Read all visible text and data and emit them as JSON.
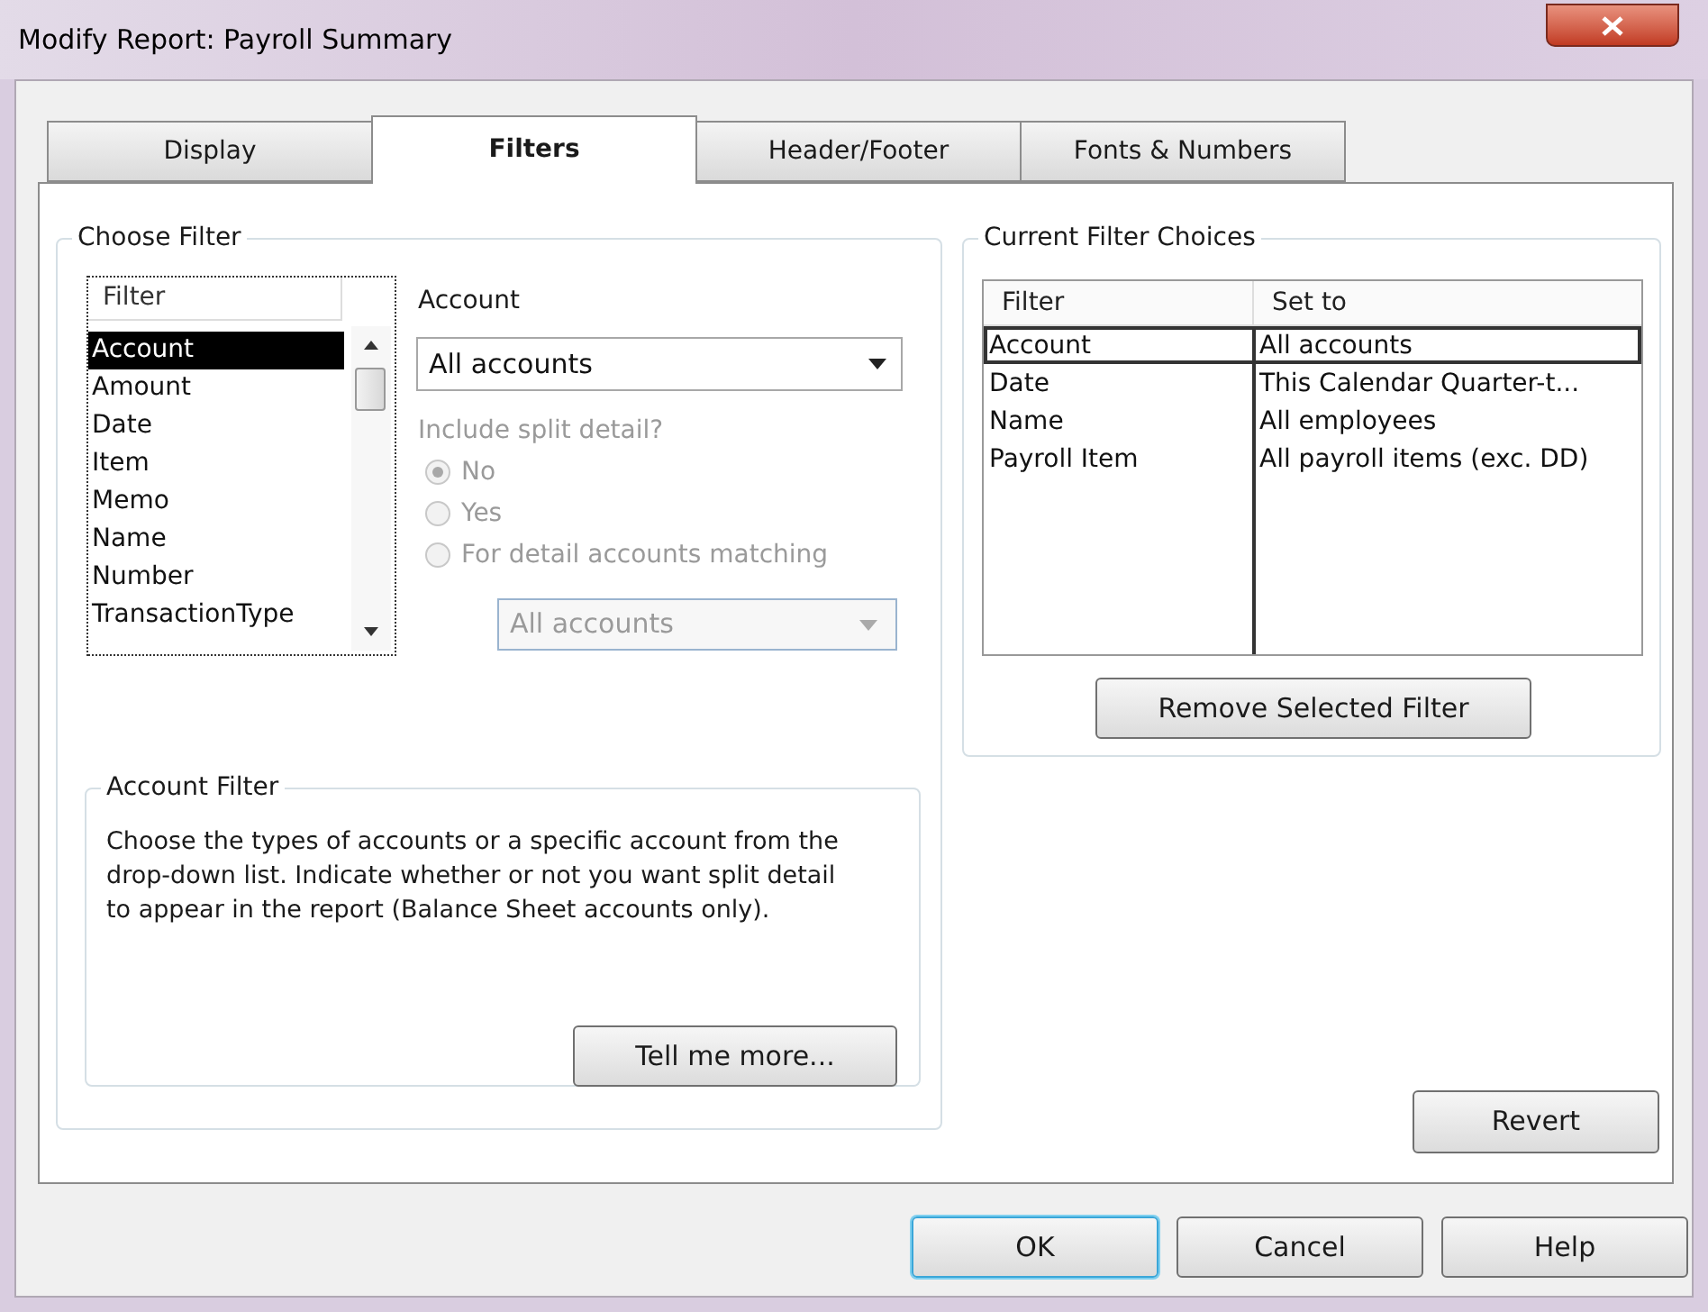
{
  "window": {
    "title": "Modify Report: Payroll Summary"
  },
  "tabs": [
    {
      "label": "Display",
      "selected": false
    },
    {
      "label": "Filters",
      "selected": true
    },
    {
      "label": "Header/Footer",
      "selected": false
    },
    {
      "label": "Fonts & Numbers",
      "selected": false
    }
  ],
  "choose_filter": {
    "title": "Choose Filter",
    "filter_list": {
      "header": "Filter",
      "items": [
        {
          "label": "Account",
          "selected": true
        },
        {
          "label": "Amount",
          "selected": false
        },
        {
          "label": "Date",
          "selected": false
        },
        {
          "label": "Item",
          "selected": false
        },
        {
          "label": "Memo",
          "selected": false
        },
        {
          "label": "Name",
          "selected": false
        },
        {
          "label": "Number",
          "selected": false
        },
        {
          "label": "TransactionType",
          "selected": false
        }
      ]
    },
    "account_label": "Account",
    "account_dropdown": {
      "value": "All accounts"
    },
    "split_detail": {
      "label": "Include split detail?",
      "disabled": true,
      "options": [
        {
          "label": "No",
          "selected": true
        },
        {
          "label": "Yes",
          "selected": false
        },
        {
          "label": "For detail accounts matching",
          "selected": false
        }
      ],
      "match_dropdown": {
        "value": "All accounts"
      }
    },
    "account_filter": {
      "title": "Account Filter",
      "text": "Choose the types of accounts or a specific account from the drop-down list. Indicate whether or not you want split detail to appear in the report (Balance Sheet accounts only).",
      "button": "Tell me more..."
    }
  },
  "current_filter_choices": {
    "title": "Current Filter Choices",
    "columns": [
      "Filter",
      "Set to"
    ],
    "rows": [
      {
        "filter": "Account",
        "set_to": "All accounts",
        "selected": true
      },
      {
        "filter": "Date",
        "set_to": "This Calendar Quarter-t...",
        "selected": false
      },
      {
        "filter": "Name",
        "set_to": "All employees",
        "selected": false
      },
      {
        "filter": "Payroll Item",
        "set_to": "All payroll items (exc. DD)",
        "selected": false
      }
    ],
    "button": "Remove Selected Filter"
  },
  "revert_button": "Revert",
  "buttons": [
    {
      "label": "OK",
      "default": true
    },
    {
      "label": "Cancel",
      "default": false
    },
    {
      "label": "Help",
      "default": false
    }
  ]
}
